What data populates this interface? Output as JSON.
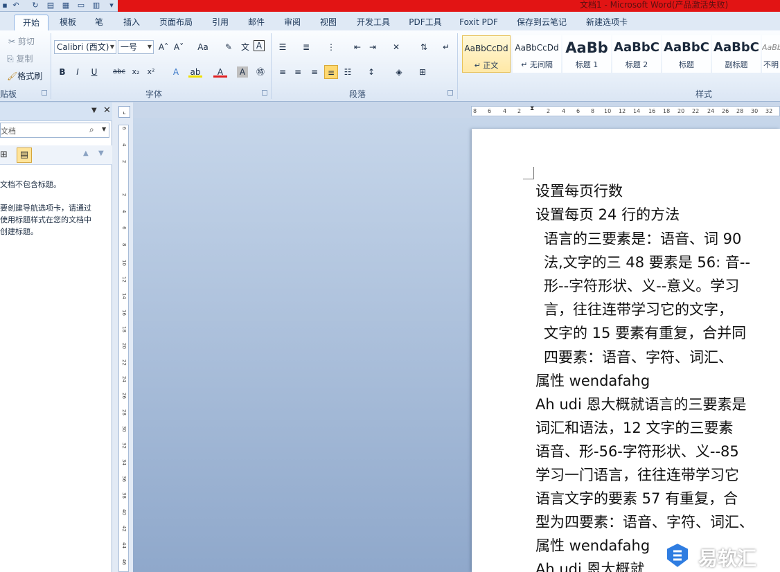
{
  "window": {
    "title": "文档1 - Microsoft Word(产品激活失败)"
  },
  "tabs": [
    "开始",
    "模板",
    "笔",
    "插入",
    "页面布局",
    "引用",
    "邮件",
    "审阅",
    "视图",
    "开发工具",
    "PDF工具",
    "Foxit PDF",
    "保存到云笔记",
    "新建选项卡"
  ],
  "active_tab": "开始",
  "clipboard": {
    "cut": "剪切",
    "copy": "复制",
    "format_painter": "格式刷",
    "group_label": "贴板"
  },
  "font": {
    "name": "Calibri (西文)",
    "size": "一号",
    "group_label": "字体"
  },
  "paragraph": {
    "group_label": "段落"
  },
  "styles": {
    "group_label": "样式",
    "items": [
      {
        "sample": "AaBbCcDd",
        "name": "↵ 正文"
      },
      {
        "sample": "AaBbCcDd",
        "name": "↵ 无间隔"
      },
      {
        "sample": "AaBb",
        "name": "标题 1"
      },
      {
        "sample": "AaBbC",
        "name": "标题 2"
      },
      {
        "sample": "AaBbC",
        "name": "标题"
      },
      {
        "sample": "AaBbC",
        "name": "副标题"
      },
      {
        "sample": "AaBb",
        "name": "不明"
      }
    ]
  },
  "nav_pane": {
    "search_placeholder": "文档",
    "message_1": "文档不包含标题。",
    "message_2": "要创建导航选项卡，请通过",
    "message_3": "使用标题样式在您的文档中",
    "message_4": "创建标题。"
  },
  "ruler": {
    "h_ticks": [
      "8",
      "6",
      "4",
      "2",
      "2",
      "4",
      "6",
      "8",
      "10",
      "12",
      "14",
      "16",
      "18",
      "20",
      "22",
      "24",
      "26",
      "28",
      "30",
      "32"
    ],
    "v_ticks": [
      "6",
      "4",
      "2",
      "2",
      "4",
      "6",
      "8",
      "10",
      "12",
      "14",
      "16",
      "18",
      "20",
      "22",
      "24",
      "26",
      "28",
      "30",
      "32",
      "34",
      "36",
      "38",
      "40",
      "42",
      "44",
      "46"
    ]
  },
  "document": {
    "lines": [
      "设置每页行数",
      "设置每页 24 行的方法",
      "语言的三要素是：语音、词 90",
      "法,文字的三 48 要素是 56: 音--",
      "形--字符形状、义--意义。学习",
      "言，往往连带学习它的文字，",
      "文字的 15 要素有重复，合并同",
      "四要素：语音、字符、词汇、",
      "属性 wendafahg",
      "Ah udi 恩大概就语言的三要素是",
      "词汇和语法，12 文字的三要素",
      "语音、形-56-字符形状、义--85",
      "学习一门语言，往往连带学习它",
      "语言文字的要素 57 有重复，合",
      "型为四要素：语音、字符、词汇、",
      "属性 wendafahg",
      "Ah udi 恩大概就"
    ]
  },
  "watermark": {
    "text": "易软汇"
  },
  "colors": {
    "title_bar": "#e21414",
    "accent": "#2a5fa9",
    "page": "#ffffff"
  }
}
